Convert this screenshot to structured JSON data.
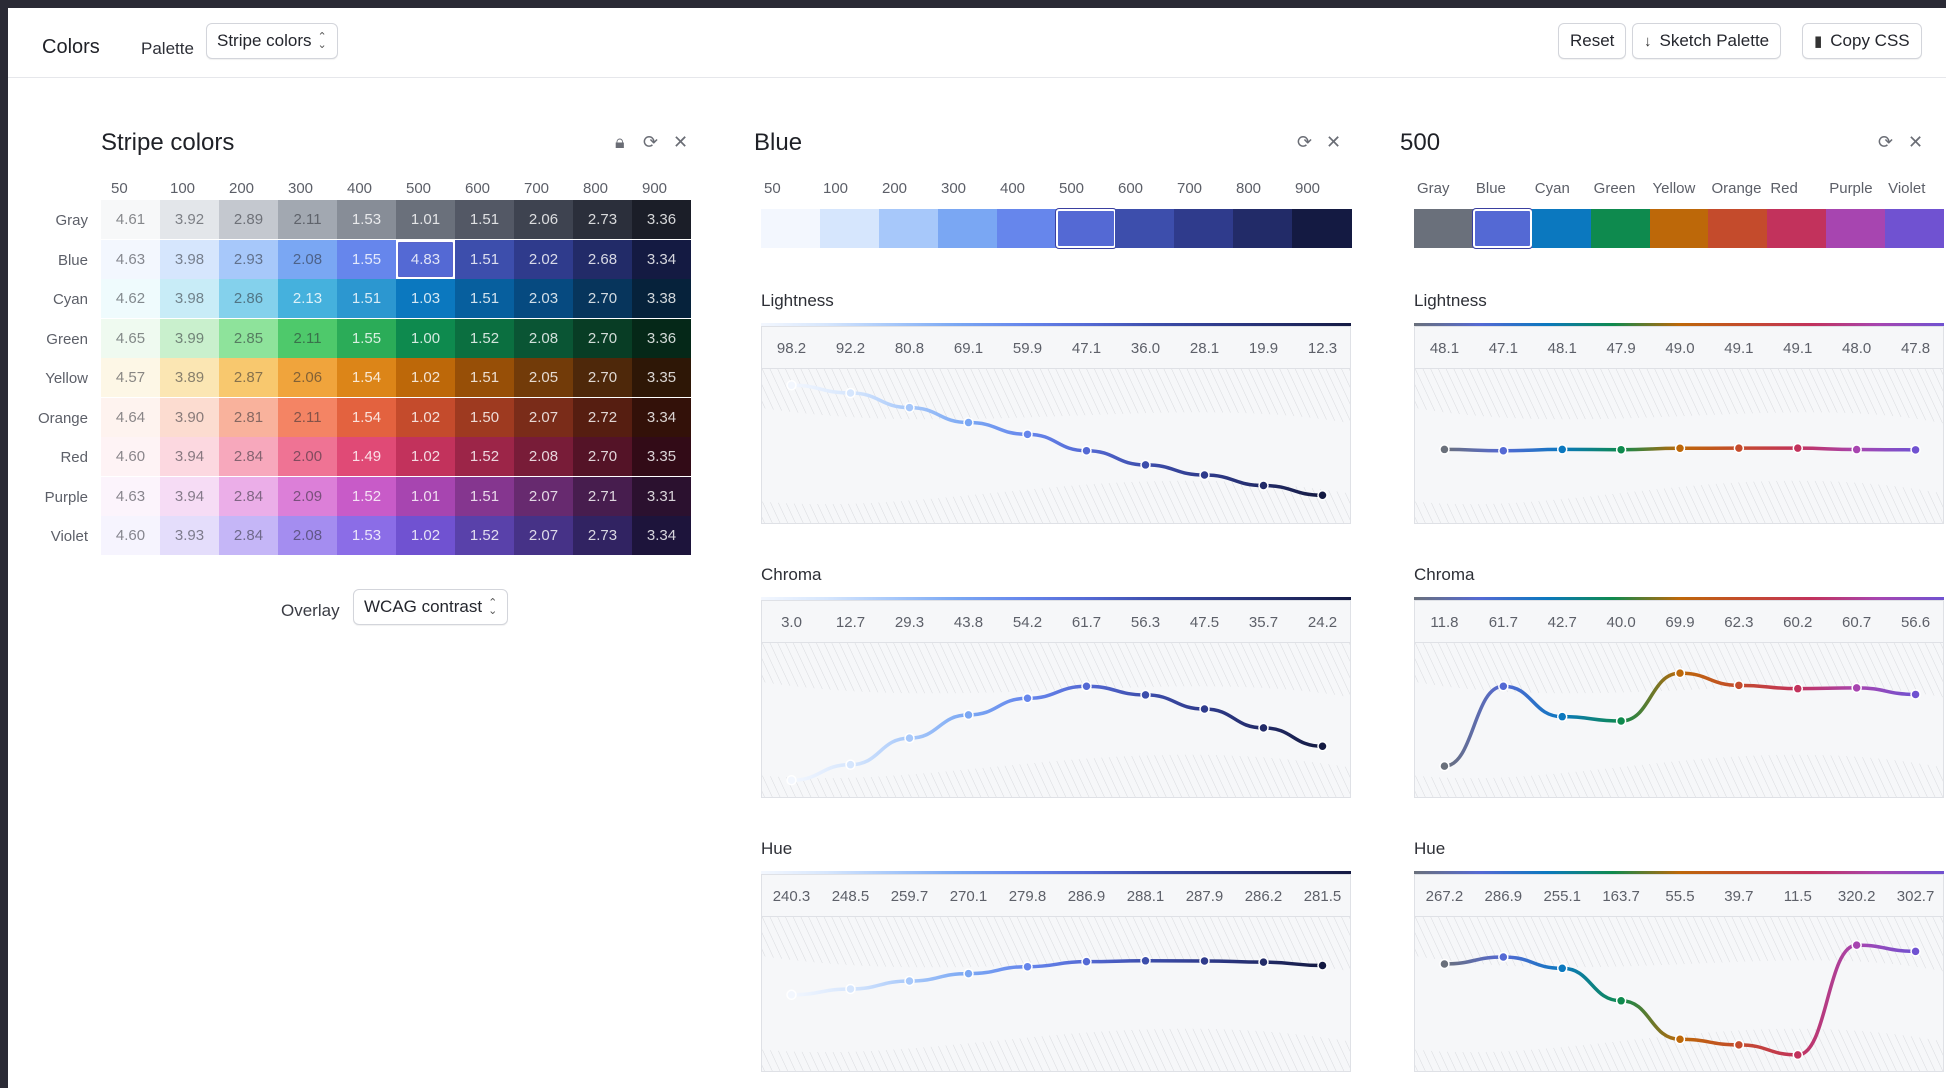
{
  "app": {
    "title": "Colors",
    "palette_label": "Palette",
    "palette_select": "Stripe colors",
    "buttons": {
      "reset": "Reset",
      "sketch": "Sketch Palette",
      "copy": "Copy CSS"
    }
  },
  "steps": [
    "50",
    "100",
    "200",
    "300",
    "400",
    "500",
    "600",
    "700",
    "800",
    "900"
  ],
  "hues": [
    "Gray",
    "Blue",
    "Cyan",
    "Green",
    "Yellow",
    "Orange",
    "Red",
    "Purple",
    "Violet"
  ],
  "left_panel": {
    "title": "Stripe colors",
    "overlay_label": "Overlay",
    "overlay_select": "WCAG contrast",
    "rows": [
      {
        "name": "Gray",
        "colors": [
          "#f7f8f9",
          "#e3e6ea",
          "#c4c8cf",
          "#a2a8b1",
          "#878d97",
          "#6a707b",
          "#535865",
          "#3e4350",
          "#2b2f3b",
          "#1b1e28"
        ],
        "values": [
          "4.61",
          "3.92",
          "2.89",
          "2.11",
          "1.53",
          "1.01",
          "1.51",
          "2.06",
          "2.73",
          "3.36"
        ]
      },
      {
        "name": "Blue",
        "colors": [
          "#f3f7fe",
          "#d6e6fd",
          "#a7c8fa",
          "#7aa7f3",
          "#6686ec",
          "#5469d4",
          "#3d4eac",
          "#2f3b8c",
          "#222b68",
          "#141a42"
        ],
        "values": [
          "4.63",
          "3.98",
          "2.93",
          "2.08",
          "1.55",
          "4.83",
          "1.51",
          "2.02",
          "2.68",
          "3.34"
        ]
      },
      {
        "name": "Cyan",
        "colors": [
          "#effbfd",
          "#c8ecf7",
          "#84d1ec",
          "#45b1dd",
          "#2c97d0",
          "#0b78bf",
          "#075f9e",
          "#064a80",
          "#07355c",
          "#06223b"
        ],
        "values": [
          "4.62",
          "3.98",
          "2.86",
          "2.13",
          "1.51",
          "1.03",
          "1.51",
          "2.03",
          "2.70",
          "3.38"
        ]
      },
      {
        "name": "Green",
        "colors": [
          "#effaf0",
          "#c9f0cd",
          "#8ee39b",
          "#4ec96b",
          "#2bac58",
          "#0e8a4e",
          "#0b6f40",
          "#0a5534",
          "#083d25",
          "#052818"
        ],
        "values": [
          "4.65",
          "3.99",
          "2.85",
          "2.11",
          "1.55",
          "1.00",
          "1.52",
          "2.08",
          "2.70",
          "3.36"
        ]
      },
      {
        "name": "Yellow",
        "colors": [
          "#fdf7e6",
          "#fbe6b3",
          "#f8c86e",
          "#f0a43c",
          "#dc8518",
          "#bd6809",
          "#974f07",
          "#723b09",
          "#4e280a",
          "#2e1706"
        ],
        "values": [
          "4.57",
          "3.89",
          "2.87",
          "2.06",
          "1.54",
          "1.02",
          "1.51",
          "2.05",
          "2.70",
          "3.35"
        ]
      },
      {
        "name": "Orange",
        "colors": [
          "#fef3ef",
          "#fcdcd0",
          "#f9b29c",
          "#f48464",
          "#e3623f",
          "#c44b2c",
          "#9e3a20",
          "#7a2c19",
          "#561e11",
          "#331109"
        ],
        "values": [
          "4.64",
          "3.90",
          "2.81",
          "2.11",
          "1.54",
          "1.02",
          "1.50",
          "2.07",
          "2.72",
          "3.34"
        ]
      },
      {
        "name": "Red",
        "colors": [
          "#fef3f5",
          "#fcd8e0",
          "#f7a8bc",
          "#ef7394",
          "#e04a76",
          "#c2325c",
          "#9c2548",
          "#781c38",
          "#541327",
          "#320b17"
        ],
        "values": [
          "4.60",
          "3.94",
          "2.84",
          "2.00",
          "1.49",
          "1.02",
          "1.52",
          "2.08",
          "2.70",
          "3.35"
        ]
      },
      {
        "name": "Purple",
        "colors": [
          "#fcf4fc",
          "#f6dcf5",
          "#ebaee8",
          "#dc7fd8",
          "#c85bc8",
          "#a745b0",
          "#85368f",
          "#672a6f",
          "#471d4e",
          "#2b112f"
        ],
        "values": [
          "4.63",
          "3.94",
          "2.84",
          "2.09",
          "1.52",
          "1.01",
          "1.51",
          "2.07",
          "2.71",
          "3.31"
        ]
      },
      {
        "name": "Violet",
        "colors": [
          "#f6f4fe",
          "#e4ddfb",
          "#c5b6f7",
          "#a48df0",
          "#8b6de7",
          "#7052d1",
          "#5941aa",
          "#463287",
          "#312362",
          "#1d143b"
        ],
        "values": [
          "4.60",
          "3.93",
          "2.84",
          "2.08",
          "1.53",
          "1.02",
          "1.52",
          "2.07",
          "2.73",
          "3.34"
        ]
      }
    ]
  },
  "mid_panel": {
    "title": "Blue",
    "colors": [
      "#f3f7fe",
      "#d6e6fd",
      "#a7c8fa",
      "#7aa7f3",
      "#6686ec",
      "#5469d4",
      "#3d4eac",
      "#2f3b8c",
      "#222b68",
      "#141a42"
    ],
    "lightness": {
      "label": "Lightness",
      "values": [
        "98.2",
        "92.2",
        "80.8",
        "69.1",
        "59.9",
        "47.1",
        "36.0",
        "28.1",
        "19.9",
        "12.3"
      ]
    },
    "chroma": {
      "label": "Chroma",
      "values": [
        "3.0",
        "12.7",
        "29.3",
        "43.8",
        "54.2",
        "61.7",
        "56.3",
        "47.5",
        "35.7",
        "24.2"
      ]
    },
    "hue": {
      "label": "Hue",
      "values": [
        "240.3",
        "248.5",
        "259.7",
        "270.1",
        "279.8",
        "286.9",
        "288.1",
        "287.9",
        "286.2",
        "281.5"
      ]
    }
  },
  "right_panel": {
    "title": "500",
    "colors": [
      "#6a707b",
      "#5469d4",
      "#0b78bf",
      "#0e8a4e",
      "#bd6809",
      "#c44b2c",
      "#c2325c",
      "#a745b0",
      "#7052d1"
    ],
    "lightness": {
      "label": "Lightness",
      "values": [
        "48.1",
        "47.1",
        "48.1",
        "47.9",
        "49.0",
        "49.1",
        "49.1",
        "48.0",
        "47.8"
      ]
    },
    "chroma": {
      "label": "Chroma",
      "values": [
        "11.8",
        "61.7",
        "42.7",
        "40.0",
        "69.9",
        "62.3",
        "60.2",
        "60.7",
        "56.6"
      ]
    },
    "hue": {
      "label": "Hue",
      "values": [
        "267.2",
        "286.9",
        "255.1",
        "163.7",
        "55.5",
        "39.7",
        "11.5",
        "320.2",
        "302.7"
      ]
    }
  }
}
